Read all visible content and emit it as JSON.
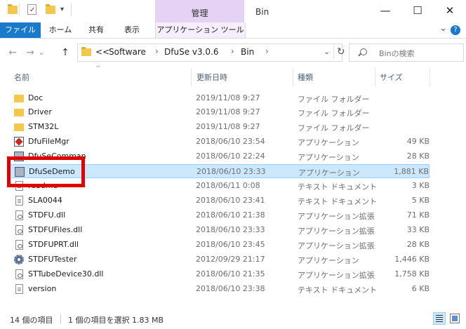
{
  "title_bar": {
    "context_tab_label": "管理",
    "window_title": "Bin",
    "minimize": "—",
    "maximize": "☐",
    "close": "✕"
  },
  "ribbon": {
    "file": "ファイル",
    "home": "ホーム",
    "share": "共有",
    "view": "表示",
    "app_tools": "アプリケーション ツール",
    "expand": "⌄",
    "help": "?"
  },
  "nav": {
    "back": "←",
    "forward": "→",
    "recent": "⌄",
    "up": "↑",
    "overflow": "<<",
    "crumbs": [
      "Software",
      "DfuSe v3.0.6",
      "Bin"
    ],
    "sep": "›",
    "dropdown": "⌄",
    "refresh": "↻",
    "search_placeholder": "Binの検索"
  },
  "columns": {
    "name": "名前",
    "date": "更新日時",
    "type": "種類",
    "size": "サイズ"
  },
  "files": [
    {
      "name": "Doc",
      "date": "2019/11/08 9:27",
      "type": "ファイル フォルダー",
      "size": "",
      "icon": "folder-icon"
    },
    {
      "name": "Driver",
      "date": "2019/11/08 9:27",
      "type": "ファイル フォルダー",
      "size": "",
      "icon": "folder-icon"
    },
    {
      "name": "STM32L",
      "date": "2019/11/08 9:27",
      "type": "ファイル フォルダー",
      "size": "",
      "icon": "folder-icon"
    },
    {
      "name": "DfuFileMgr",
      "date": "2018/06/10 23:54",
      "type": "アプリケーション",
      "size": "49 KB",
      "icon": "application-icon"
    },
    {
      "name": "DfuSeComman",
      "date": "2018/06/10 22:24",
      "type": "アプリケーション",
      "size": "28 KB",
      "icon": "application-icon"
    },
    {
      "name": "DfuSeDemo",
      "date": "2018/06/10 23:33",
      "type": "アプリケーション",
      "size": "1,881 KB",
      "icon": "application-icon"
    },
    {
      "name": "readme",
      "date": "2018/06/11 0:08",
      "type": "テキスト ドキュメント",
      "size": "3 KB",
      "icon": "text-document-icon"
    },
    {
      "name": "SLA0044",
      "date": "2018/06/10 23:41",
      "type": "テキスト ドキュメント",
      "size": "5 KB",
      "icon": "text-document-icon"
    },
    {
      "name": "STDFU.dll",
      "date": "2018/06/10 21:38",
      "type": "アプリケーション拡張",
      "size": "71 KB",
      "icon": "dll-icon"
    },
    {
      "name": "STDFUFiles.dll",
      "date": "2018/06/10 23:33",
      "type": "アプリケーション拡張",
      "size": "33 KB",
      "icon": "dll-icon"
    },
    {
      "name": "STDFUPRT.dll",
      "date": "2018/06/10 23:45",
      "type": "アプリケーション拡張",
      "size": "28 KB",
      "icon": "dll-icon"
    },
    {
      "name": "STDFUTester",
      "date": "2012/09/29 21:17",
      "type": "アプリケーション",
      "size": "1,446 KB",
      "icon": "gear-icon"
    },
    {
      "name": "STTubeDevice30.dll",
      "date": "2018/06/10 21:35",
      "type": "アプリケーション拡張",
      "size": "1,758 KB",
      "icon": "dll-icon"
    },
    {
      "name": "version",
      "date": "2018/06/10 23:38",
      "type": "テキスト ドキュメント",
      "size": "6 KB",
      "icon": "text-document-icon"
    }
  ],
  "selected_file": "DfuSeDemo",
  "status": {
    "item_count": "14 個の項目",
    "selection": "1 個の項目を選択  1.83 MB"
  },
  "colors": {
    "accent": "#1979ca",
    "context_tab": "#e6d2f3",
    "selection": "#cce8ff",
    "highlight_box": "#e10000"
  }
}
